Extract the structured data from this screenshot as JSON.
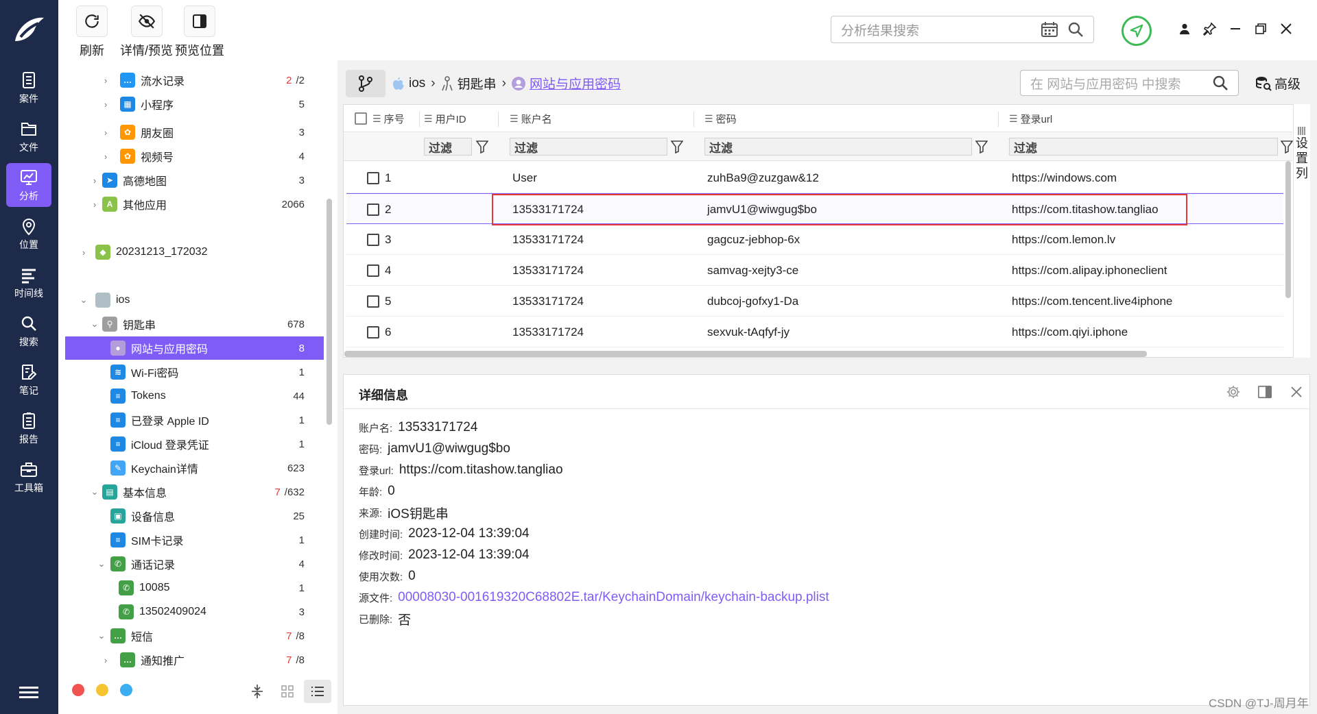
{
  "rail": {
    "items": [
      {
        "label": "案件",
        "icon": "case-icon"
      },
      {
        "label": "文件",
        "icon": "folder-icon"
      },
      {
        "label": "分析",
        "icon": "analysis-icon",
        "active": true
      },
      {
        "label": "位置",
        "icon": "location-icon"
      },
      {
        "label": "时间线",
        "icon": "timeline-icon"
      },
      {
        "label": "搜索",
        "icon": "search-icon"
      },
      {
        "label": "笔记",
        "icon": "note-icon"
      },
      {
        "label": "报告",
        "icon": "report-icon"
      },
      {
        "label": "工具箱",
        "icon": "toolbox-icon"
      }
    ]
  },
  "toolbar": {
    "refresh_label": "刷新",
    "detail_preview_label": "详情/预览",
    "preview_position_label": "预览位置",
    "search_placeholder": "分析结果搜索"
  },
  "tree": {
    "rows": [
      {
        "label": "流水记录",
        "count_red": "2",
        "count": "/2",
        "icon": "chat-bubble-icon",
        "color": "#2196f3"
      },
      {
        "label": "小程序",
        "count": "5",
        "icon": "mini-program-icon",
        "color": "#1e88e5"
      },
      {
        "label": "朋友圈",
        "count": "3",
        "icon": "moments-icon",
        "color": "#ff9800"
      },
      {
        "label": "视频号",
        "count": "4",
        "icon": "video-channel-icon",
        "color": "#ff9800"
      },
      {
        "label": "高德地图",
        "count": "3",
        "icon": "amap-icon",
        "color": "#1e88e5"
      },
      {
        "label": "其他应用",
        "count": "2066",
        "icon": "app-icon",
        "color": "#8bc34a"
      },
      {
        "label": "20231213_172032",
        "count": "",
        "icon": "android-icon",
        "color": "#8bc34a"
      },
      {
        "label": "ios",
        "count": "",
        "icon": "apple-icon",
        "color": "#b0bec5"
      },
      {
        "label": "钥匙串",
        "count": "678",
        "icon": "keychain-icon",
        "color": "#9e9e9e"
      },
      {
        "label": "网站与应用密码",
        "count": "8",
        "icon": "user-circle-icon",
        "color": "#b39ddb",
        "selected": true
      },
      {
        "label": "Wi-Fi密码",
        "count": "1",
        "icon": "wifi-icon",
        "color": "#1e88e5"
      },
      {
        "label": "Tokens",
        "count": "44",
        "icon": "list-icon",
        "color": "#1e88e5"
      },
      {
        "label": "已登录 Apple ID",
        "count": "1",
        "icon": "list-icon",
        "color": "#1e88e5"
      },
      {
        "label": "iCloud 登录凭证",
        "count": "1",
        "icon": "list-icon",
        "color": "#1e88e5"
      },
      {
        "label": "Keychain详情",
        "count": "623",
        "icon": "key-icon",
        "color": "#42a5f5"
      },
      {
        "label": "基本信息",
        "count_red": "7",
        "count": "/632",
        "icon": "info-book-icon",
        "color": "#26a69a"
      },
      {
        "label": "设备信息",
        "count": "25",
        "icon": "device-icon",
        "color": "#26a69a"
      },
      {
        "label": "SIM卡记录",
        "count": "1",
        "icon": "list-icon",
        "color": "#1e88e5"
      },
      {
        "label": "通话记录",
        "count": "4",
        "icon": "phone-icon",
        "color": "#43a047"
      },
      {
        "label": "10085",
        "count": "1",
        "icon": "phone-icon",
        "color": "#43a047"
      },
      {
        "label": "13502409024",
        "count": "3",
        "icon": "phone-icon",
        "color": "#43a047"
      },
      {
        "label": "短信",
        "count_red": "7",
        "count": "/8",
        "icon": "sms-icon",
        "color": "#43a047"
      },
      {
        "label": "通知推广",
        "count_red": "7",
        "count": "/8",
        "icon": "sms-icon",
        "color": "#43a047"
      }
    ]
  },
  "breadcrumb": {
    "items": [
      "ios",
      "钥匙串",
      "网站与应用密码"
    ],
    "search_placeholder": "在 网站与应用密码 中搜索",
    "advanced_label": "高级"
  },
  "grid": {
    "columns": [
      "序号",
      "用户ID",
      "账户名",
      "密码",
      "登录url"
    ],
    "filter_label": "过滤",
    "settings_label": "设置列",
    "rows": [
      {
        "index": "1",
        "user_id": "",
        "account": "User",
        "password": "zuhBa9@zuzgaw&12",
        "url": "https://windows.com"
      },
      {
        "index": "2",
        "user_id": "",
        "account": "13533171724",
        "password": "jamvU1@wiwgug$bo",
        "url": "https://com.titashow.tangliao",
        "selected": true
      },
      {
        "index": "3",
        "user_id": "",
        "account": "13533171724",
        "password": "gagcuz-jebhop-6x",
        "url": "https://com.lemon.lv"
      },
      {
        "index": "4",
        "user_id": "",
        "account": "13533171724",
        "password": "samvag-xejty3-ce",
        "url": "https://com.alipay.iphoneclient"
      },
      {
        "index": "5",
        "user_id": "",
        "account": "13533171724",
        "password": "dubcoj-gofxy1-Da",
        "url": "https://com.tencent.live4iphone"
      },
      {
        "index": "6",
        "user_id": "",
        "account": "13533171724",
        "password": "sexvuk-tAqfyf-jy",
        "url": "https://com.qiyi.iphone"
      }
    ]
  },
  "detail": {
    "title": "详细信息",
    "fields": [
      {
        "key": "账户名:",
        "value": "13533171724"
      },
      {
        "key": "密码:",
        "value": "jamvU1@wiwgug$bo"
      },
      {
        "key": "登录url:",
        "value": "https://com.titashow.tangliao"
      },
      {
        "key": "年龄:",
        "value": "0"
      },
      {
        "key": "来源:",
        "value": "iOS钥匙串"
      },
      {
        "key": "创建时间:",
        "value": "2023-12-04 13:39:04"
      },
      {
        "key": "修改时间:",
        "value": "2023-12-04 13:39:04"
      },
      {
        "key": "使用次数:",
        "value": "0"
      },
      {
        "key": "源文件:",
        "value": "00008030-001619320C68802E.tar/KeychainDomain/keychain-backup.plist",
        "link": true
      },
      {
        "key": "已删除:",
        "value": "否"
      }
    ]
  },
  "colors": {
    "accent": "#7e5cf5",
    "rail": "#1e2a4a",
    "highlight_box": "#e53935",
    "ok_green": "#3cba54"
  },
  "watermark": "CSDN @TJ-周月年"
}
